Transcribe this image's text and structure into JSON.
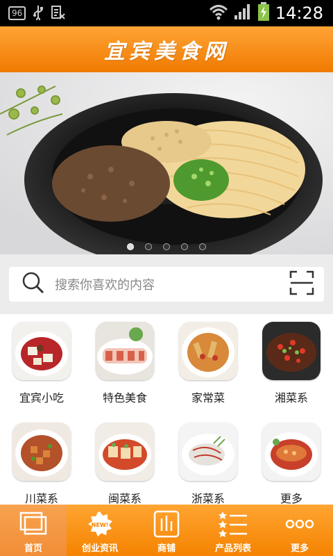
{
  "status_bar": {
    "notification_badge": "96",
    "time": "14:28",
    "icons": [
      "sd-card-icon",
      "usb-icon",
      "clipboard-icon",
      "wifi-icon",
      "signal-icon",
      "battery-charging-icon"
    ]
  },
  "header": {
    "title": "宜宾美食网"
  },
  "banner": {
    "slide_count": 5,
    "active_slide": 1
  },
  "search": {
    "placeholder": "搜索你喜欢的内容",
    "icons": [
      "search-icon",
      "scan-icon"
    ]
  },
  "categories": [
    {
      "label": "宜宾小吃"
    },
    {
      "label": "特色美食"
    },
    {
      "label": "家常菜"
    },
    {
      "label": "湘菜系"
    },
    {
      "label": "川菜系"
    },
    {
      "label": "闽菜系"
    },
    {
      "label": "浙菜系"
    },
    {
      "label": "更多"
    }
  ],
  "bottom_nav": {
    "items": [
      {
        "label": "首页",
        "icon": "home-icon",
        "active": true
      },
      {
        "label": "创业资讯",
        "icon": "new-badge-icon",
        "active": false
      },
      {
        "label": "商铺",
        "icon": "shop-chart-icon",
        "active": false
      },
      {
        "label": "产品列表",
        "icon": "star-list-icon",
        "active": false
      },
      {
        "label": "更多",
        "icon": "more-dots-icon",
        "active": false
      }
    ],
    "new_badge_text": "NEW!"
  },
  "colors": {
    "accent": "#f58300",
    "header_top": "#ffa436",
    "header_bottom": "#f07a00"
  }
}
